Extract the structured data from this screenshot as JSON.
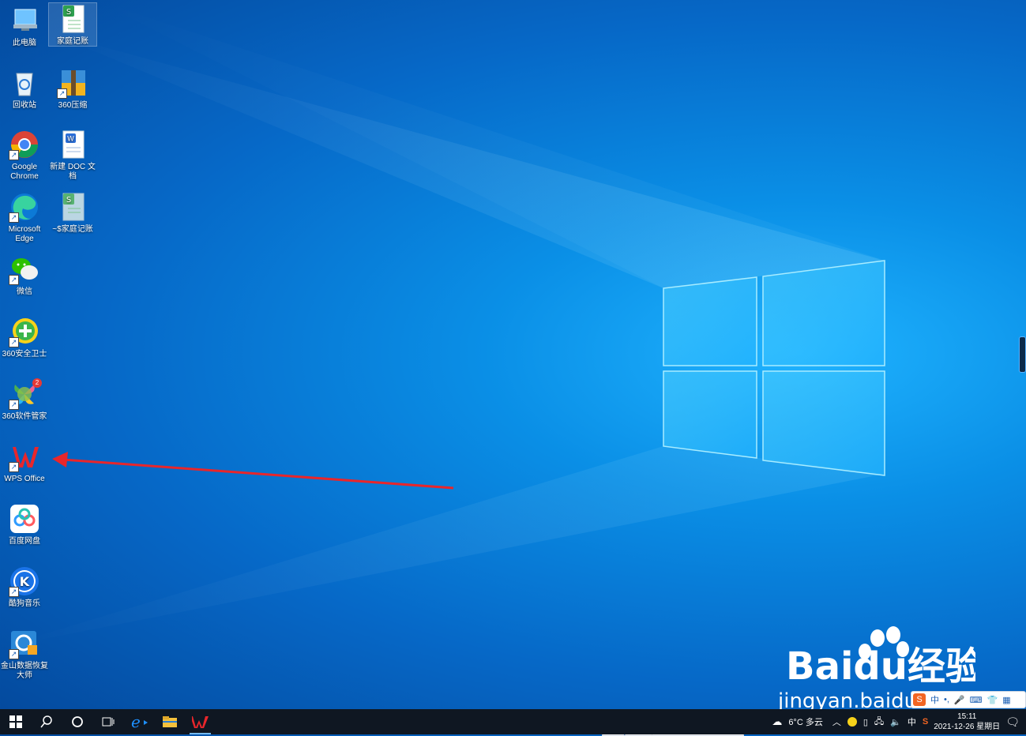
{
  "desktop": {
    "icons": [
      {
        "label": "此电脑"
      },
      {
        "label": "家庭记账"
      },
      {
        "label": "回收站"
      },
      {
        "label": "360压缩"
      },
      {
        "label": "Google Chrome"
      },
      {
        "label": "新建 DOC 文档"
      },
      {
        "label": "Microsoft Edge"
      },
      {
        "label": "~$家庭记账"
      },
      {
        "label": "微信"
      },
      {
        "label": "360安全卫士"
      },
      {
        "label": "360软件管家"
      },
      {
        "label": "WPS Office"
      },
      {
        "label": "百度网盘"
      },
      {
        "label": "酷狗音乐"
      },
      {
        "label": "金山数据恢复大师"
      }
    ],
    "badge_360_manager": "2",
    "annotation_arrow_color": "#e8262b"
  },
  "taskbar": {
    "start": "windows-logo-icon",
    "search": "search-icon",
    "cortana": "cortana-icon",
    "task_view": "task-view-icon",
    "apps": [
      "ie-icon",
      "file-explorer-icon",
      "wps-icon"
    ]
  },
  "tray": {
    "weather": "6°C 多云",
    "ime_lang": "中",
    "time": "15:11",
    "date": "2021-12-26 星期日"
  },
  "ime_toolbar": {
    "lang": "中"
  },
  "watermark": {
    "brand": "Baidu经验",
    "url": "jingyan.baidu.com"
  },
  "colors": {
    "taskbar": "#0f1722",
    "accent": "#76b9ed",
    "wps_red": "#e8262b"
  }
}
